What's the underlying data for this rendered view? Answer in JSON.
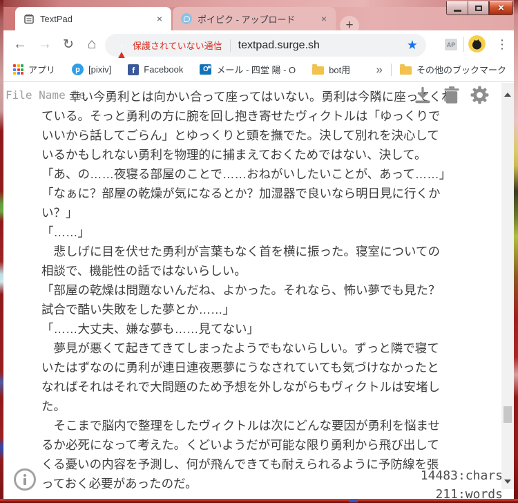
{
  "browser": {
    "tabs": [
      {
        "title": "TextPad",
        "active": true
      },
      {
        "title": "ポイピク - アップロード",
        "active": false
      }
    ],
    "omnibox": {
      "security_warning": "保護されていない通信",
      "url": "textpad.surge.sh"
    },
    "extension_badge": "AP",
    "bookmarks_bar": {
      "items": [
        {
          "label": "アプリ",
          "icon": "apps-grid-icon"
        },
        {
          "label": "[pixiv]",
          "icon": "pixiv-icon"
        },
        {
          "label": "Facebook",
          "icon": "facebook-icon"
        },
        {
          "label": "メール - 四堂 陽 - O",
          "icon": "outlook-icon"
        },
        {
          "label": "bot用",
          "icon": "folder-icon"
        }
      ],
      "overflow_chevron": "»",
      "other_bookmarks": "その他のブックマーク"
    }
  },
  "glyphs": {
    "back": "←",
    "forward": "→",
    "reload": "↻",
    "home": "⌂",
    "star": "★",
    "dots": "⋮",
    "tab_close": "×",
    "window_close": "×",
    "plus": "+",
    "warning_mark": "!",
    "pixiv_letter": "p",
    "facebook_letter": "f",
    "outlook_letter": "O"
  },
  "page": {
    "filename_placeholder": "File Name Here",
    "text_lines": [
      "幸い今勇利とは向かい合って座ってはいない。勇利は今隣に座ってくれ",
      "ている。そっと勇利の方に腕を回し抱き寄せたヴィクトルは「ゆっくりで",
      "いいから話してごらん」とゆっくりと頭を撫でた。決して別れを決心して",
      "いるかもしれない勇利を物理的に捕まえておくためではない、決して。",
      "「あ、の……夜寝る部屋のことで……おねがいしたいことが、あって……」",
      "「なぁに？部屋の乾燥が気になるとか？加湿器で良いなら明日見に行くか",
      "い？」",
      "「……」",
      "　悲しげに目を伏せた勇利が言葉もなく首を横に振った。寝室についての",
      "相談で、機能性の話ではないらしい。",
      "「部屋の乾燥は問題ないんだね、よかった。それなら、怖い夢でも見た？",
      "試合で酷い失敗をした夢とか……」",
      "「……大丈夫、嫌な夢も……見てない」",
      "　夢見が悪くて起きてきてしまったようでもないらしい。ずっと隣で寝て",
      "いたはずなのに勇利が連日連夜悪夢にうなされていても気づけなかったと",
      "なればそれはそれで大問題のため予想を外しながらもヴィクトルは安堵し",
      "た。",
      "　そこまで脳内で整理をしたヴィクトルは次にどんな要因が勇利を悩ませ",
      "るか必死になって考えた。くどいようだが可能な限り勇利から飛び出して",
      "くる憂いの内容を予測し、何が飛んできても耐えられるように予防線を張",
      "っておく必要があったのだ。"
    ],
    "stats": {
      "chars": "14483:chars",
      "words": "211:words"
    }
  },
  "colors": {
    "titlebar_pink": "#db9292",
    "inactive_tab_pink": "#e9baba",
    "close_button_red": "#c0392b",
    "security_warning_red": "#d93025",
    "bookmark_star_blue": "#1a73e8",
    "pixiv_blue": "#2e9fe6",
    "facebook_blue": "#3b5998",
    "outlook_blue": "#1272b8",
    "folder_yellow": "#f2c14e",
    "avatar_yellow": "#f6cf47",
    "text_gray": "#3e3e3e"
  }
}
